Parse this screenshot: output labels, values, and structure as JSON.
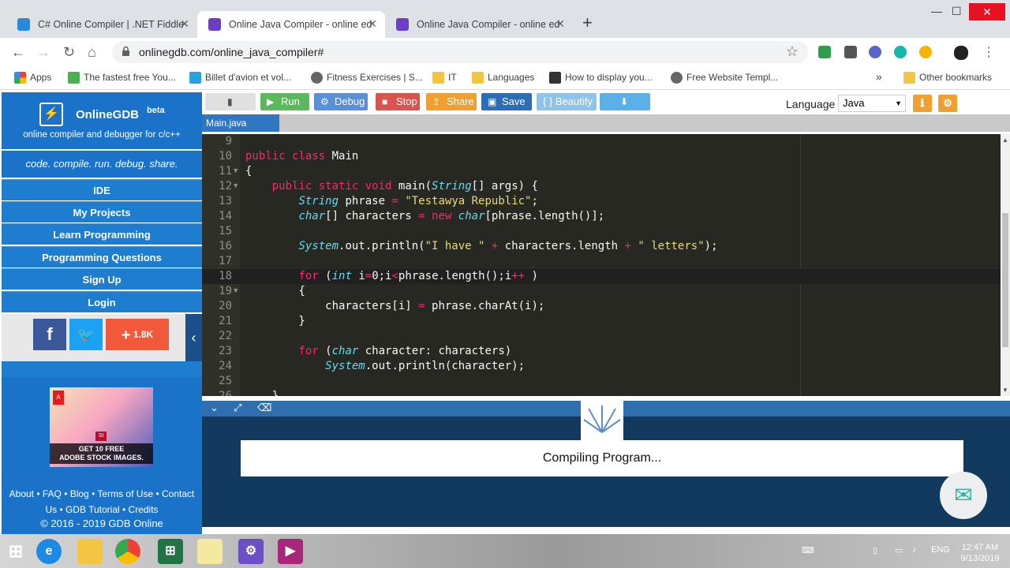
{
  "browser": {
    "tabs": [
      {
        "title": "C# Online Compiler | .NET Fiddle",
        "close": "✕"
      },
      {
        "title": "Online Java Compiler - online ed",
        "close": "✕"
      },
      {
        "title": "Online Java Compiler - online ed",
        "close": "✕"
      }
    ],
    "new_tab": "+",
    "url": "onlinegdb.com/online_java_compiler#",
    "bookmarks": [
      {
        "label": "Apps"
      },
      {
        "label": "The fastest free You..."
      },
      {
        "label": "Billet d'avion et vol..."
      },
      {
        "label": "Fitness Exercises | S..."
      },
      {
        "label": "IT"
      },
      {
        "label": "Languages"
      },
      {
        "label": "How to display you..."
      },
      {
        "label": "Free Website Templ..."
      }
    ],
    "bookmarks_more": "»",
    "other_bookmarks": "Other bookmarks"
  },
  "sidebar": {
    "brand_name": "OnlineGDB",
    "brand_beta": "beta",
    "brand_sub": "online compiler and debugger for c/c++",
    "tagline": "code. compile. run. debug. share.",
    "nav": [
      "IDE",
      "My Projects",
      "Learn Programming",
      "Programming Questions",
      "Sign Up",
      "Login"
    ],
    "share_count": "1.8K",
    "ad_text_line1": "GET 10 FREE",
    "ad_text_line2": "ADOBE STOCK IMAGES.",
    "footer_line1": "About • FAQ • Blog • Terms of Use • Contact",
    "footer_line2": "Us • GDB Tutorial • Credits",
    "copyright": "© 2016 - 2019 GDB Online"
  },
  "toolbar": {
    "run": "Run",
    "debug": "Debug",
    "stop": "Stop",
    "share": "Share",
    "save": "Save",
    "beautify": "{ } Beautify",
    "language_label": "Language",
    "language_value": "Java"
  },
  "file_tab": "Main.java",
  "console": {
    "status": "Compiling Program..."
  },
  "taskbar": {
    "lang": "ENG",
    "time": "12:47 AM",
    "date": "9/13/2019"
  },
  "colors": {
    "brand_blue": "#1a73c8",
    "editor_bg": "#272822",
    "run_green": "#5cb85c",
    "stop_red": "#d9534f"
  }
}
